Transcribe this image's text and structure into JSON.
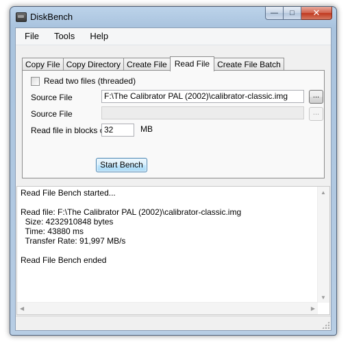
{
  "window": {
    "title": "DiskBench",
    "minimize_glyph": "—",
    "maximize_glyph": "□",
    "close_glyph": "✕"
  },
  "menu": {
    "file": "File",
    "tools": "Tools",
    "help": "Help"
  },
  "tabs": [
    {
      "label": "Copy File",
      "active": false
    },
    {
      "label": "Copy Directory",
      "active": false
    },
    {
      "label": "Create File",
      "active": false
    },
    {
      "label": "Read File",
      "active": true
    },
    {
      "label": "Create File Batch",
      "active": false
    }
  ],
  "read_file": {
    "two_files_label": "Read two files (threaded)",
    "two_files_checked": false,
    "source_label_1": "Source File",
    "source_value_1": "F:\\The Calibrator PAL (2002)\\calibrator-classic.img",
    "source_label_2": "Source File",
    "source_value_2": "",
    "browse_label": "...",
    "blocks_label": "Read file in blocks of",
    "blocks_value": "32",
    "blocks_unit": "MB",
    "start_button": "Start Bench"
  },
  "log": {
    "lines": [
      "Read File Bench started...",
      "",
      "Read file: F:\\The Calibrator PAL (2002)\\calibrator-classic.img",
      "  Size: 4232910848 bytes",
      "  Time: 43880 ms",
      "  Transfer Rate: 91,997 MB/s",
      "",
      "Read File Bench ended"
    ]
  },
  "icons": {
    "app": "app-icon",
    "scroll_up": "▲",
    "scroll_down": "▼",
    "scroll_left": "◀",
    "scroll_right": "▶"
  },
  "colors": {
    "frame": "#a9c3de",
    "close_button": "#c0391f",
    "focused_button": "#3c7fb1"
  }
}
